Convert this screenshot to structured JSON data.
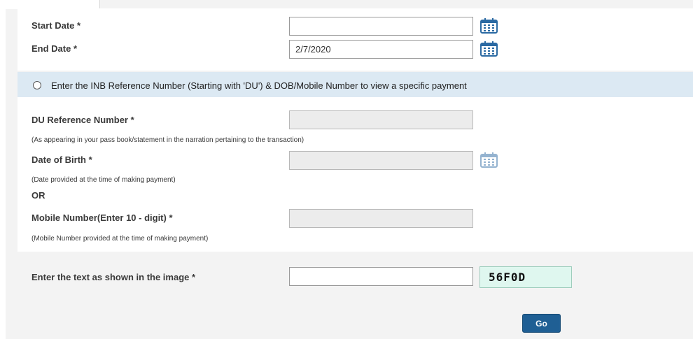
{
  "date_range": {
    "start_date_label": "Start Date *",
    "start_date_value": "",
    "end_date_label": "End Date *",
    "end_date_value": "2/7/2020"
  },
  "specific_payment": {
    "radio_label": "Enter the INB Reference Number (Starting with 'DU') & DOB/Mobile Number to view a specific payment",
    "du_reference_label": "DU Reference Number *",
    "du_reference_value": "",
    "du_reference_hint": "(As appearing in your pass book/statement in the narration pertaining to the transaction)",
    "dob_label": "Date of Birth *",
    "dob_value": "",
    "dob_hint": "(Date provided at the time of making payment)",
    "or_text": "OR",
    "mobile_label": "Mobile Number(Enter 10 - digit) *",
    "mobile_value": "",
    "mobile_hint": "(Mobile Number provided at the time of making payment)"
  },
  "captcha": {
    "label": "Enter the text as shown in the image *",
    "input_value": "",
    "image_text": "56F0D"
  },
  "actions": {
    "go_label": "Go"
  },
  "icons": {
    "calendar": "calendar-icon",
    "radio": "radio-button"
  },
  "colors": {
    "radio_bar_bg": "#dce9f3",
    "go_button": "#1f5f94",
    "captcha_bg": "#dff7ef",
    "calendar_icon": "#2b6aa3"
  }
}
